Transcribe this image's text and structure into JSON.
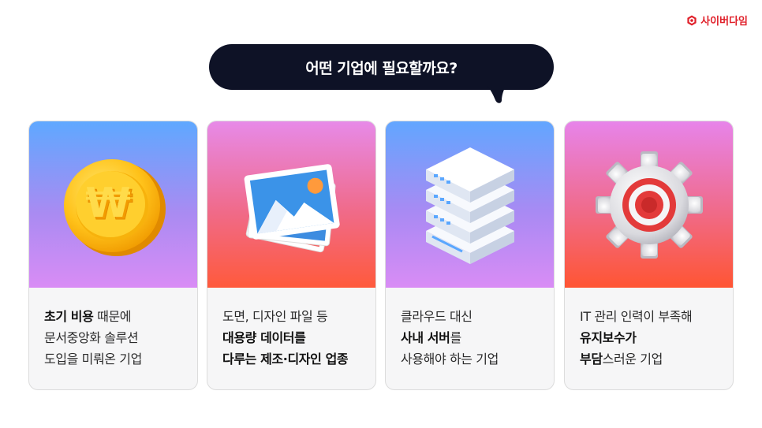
{
  "brand": {
    "name": "사이버다임",
    "color": "#e0202a"
  },
  "heading": "어떤 기업에 필요할까요?",
  "cards": [
    {
      "icon": "won-coin-icon",
      "lines": [
        {
          "bold": "초기 비용",
          "text": " 때문에"
        },
        {
          "bold": "",
          "text": "문서중앙화 솔루션"
        },
        {
          "bold": "",
          "text": "도입을 미뤄온 기업"
        }
      ]
    },
    {
      "icon": "image-stack-icon",
      "lines": [
        {
          "bold": "",
          "text": "도면, 디자인 파일 등"
        },
        {
          "bold": "대용량 데이터를",
          "text": ""
        },
        {
          "bold": "다루는 제조·디자인 업종",
          "text": ""
        }
      ]
    },
    {
      "icon": "server-icon",
      "lines": [
        {
          "bold": "",
          "text": "클라우드 대신"
        },
        {
          "bold": "사내 서버",
          "text": "를"
        },
        {
          "bold": "",
          "text": "사용해야 하는 기업"
        }
      ]
    },
    {
      "icon": "gear-icon",
      "lines": [
        {
          "bold": "",
          "text": "IT 관리 인력이 부족해"
        },
        {
          "bold": "유지보수가",
          "text": ""
        },
        {
          "bold": "부담",
          "text": "스러운 기업"
        }
      ]
    }
  ]
}
